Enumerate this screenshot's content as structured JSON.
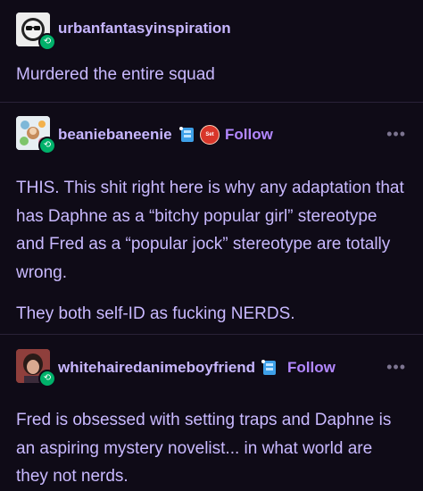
{
  "posts": [
    {
      "username": "urbanfantasyinspiration",
      "text": [
        "Murdered the entire squad"
      ]
    },
    {
      "username": "beaniebaneenie",
      "badge_label": "Set",
      "follow_label": "Follow",
      "more_label": "•••",
      "text": [
        "THIS. This shit right here is why any adaptation that has Daphne as a “bitchy popular girl” stereotype and Fred as a “popular jock” stereotype are totally wrong.",
        "They both self-ID as fucking NERDS."
      ]
    },
    {
      "username": "whitehairedanimeboyfriend",
      "follow_label": "Follow",
      "more_label": "•••",
      "text": [
        "Fred is obsessed with setting traps and Daphne is an aspiring mystery novelist... in what world are they not nerds."
      ]
    }
  ],
  "colors": {
    "background": "#0f0b17",
    "text": "#c9b9ff",
    "follow": "#b287ff",
    "reblog_badge": "#00b16a"
  },
  "icons": {
    "reblog": "reblog-icon",
    "more": "more-options-icon"
  }
}
